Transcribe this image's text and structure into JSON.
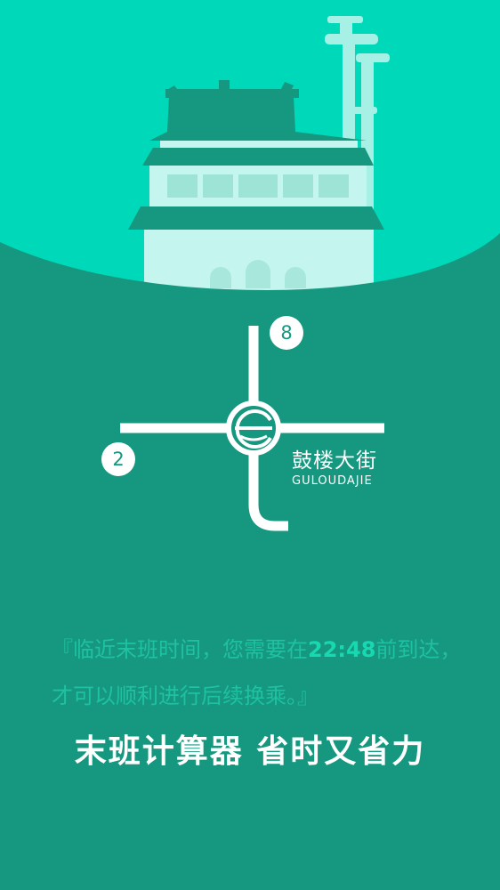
{
  "colors": {
    "sky": "#00d9b9",
    "page_background": "#15987f",
    "building_roof": "#15987f",
    "building_wall": "#c4f5ee",
    "accent_text": "#1fc1a3",
    "highlight_time": "#18d8b2",
    "white": "#ffffff"
  },
  "illustration": {
    "subject": "drum-tower-and-olympic-tower-illustration"
  },
  "station": {
    "name_cn": "鼓楼大街",
    "name_en": "GULOUDAJIE",
    "logo": "subway-logo-icon",
    "lines": [
      {
        "number": "8",
        "direction": "north"
      },
      {
        "number": "2",
        "direction": "west"
      }
    ]
  },
  "notice": {
    "prefix": "『临近末班时间，您需要在",
    "time": "22:48",
    "suffix": "前到达，才可以顺利进行后续换乘。』"
  },
  "headline": "末班计算器  省时又省力"
}
